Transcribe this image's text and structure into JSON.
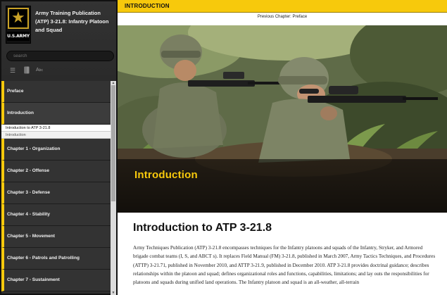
{
  "sidebar": {
    "logo": {
      "brand_text": "U.S.ARMY",
      "icon": "army-star-logo"
    },
    "book_title": "Army Training Publication (ATP) 3-21.8: Infantry Platoon and Squad",
    "search": {
      "placeholder": "search"
    },
    "tools": [
      {
        "icon": "table-of-contents-icon"
      },
      {
        "icon": "bookmark-icon"
      },
      {
        "icon": "text-size-icon"
      }
    ],
    "nav": {
      "preface": "Preface",
      "introduction": "Introduction",
      "sub_active": "Introduction to ATP 3-21.8",
      "sub_section": "Introduction",
      "chapters": [
        "Chapter 1 - Organization",
        "Chapter 2 - Offense",
        "Chapter 3 - Defense",
        "Chapter 4 - Stability",
        "Chapter 5 - Movement",
        "Chapter 6 - Patrols and Patrolling",
        "Chapter 7 - Sustainment"
      ]
    }
  },
  "main": {
    "section_label": "INTRODUCTION",
    "previous_chapter": "Previous Chapter: Preface",
    "hero_title": "Introduction",
    "heading": "Introduction to ATP 3-21.8",
    "paragraph": "Army Techniques Publication (ATP) 3-21.8 encompasses techniques for the Infantry platoons and squads of the Infantry, Stryker, and Armored brigade combat teams (I, S, and ABCT s). It replaces Field Manual (FM) 3-21.8, published in March 2007, Army Tactics Techniques, and Procedures (ATTP) 3-21.71, published in November 2010, and ATTP 3-21.9, published in December 2010. ATP 3-21.8 provides doctrinal guidance; describes relationships within the platoon and squad; defines organizational roles and functions, capabilities, limitations; and lay outs the responsibilities for platoons and squads during unified land operations. The Infantry platoon and squad is an all-weather, all-terrain"
  },
  "colors": {
    "accent_yellow": "#f7c90c",
    "sidebar_dark": "#333333"
  }
}
